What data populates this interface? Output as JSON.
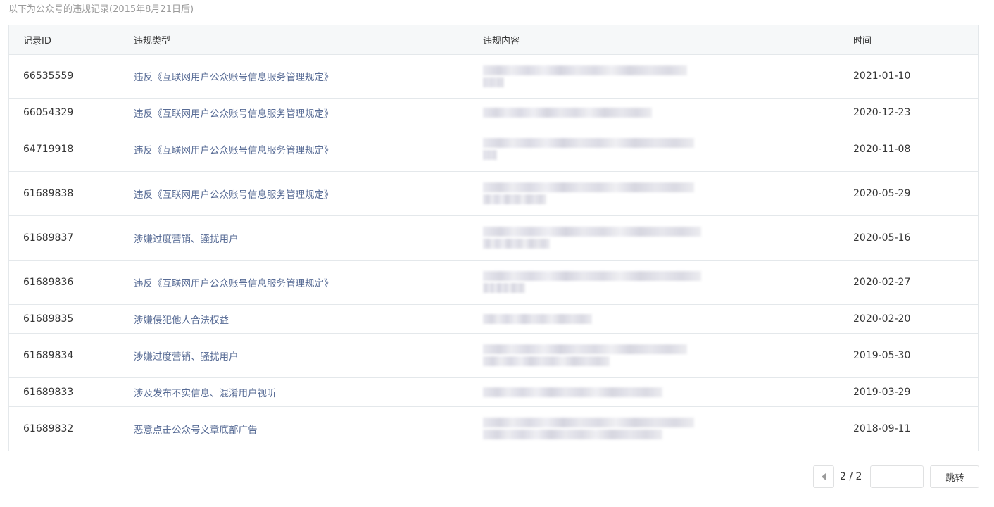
{
  "caption": "以下为公众号的违规记录(2015年8月21日后)",
  "table": {
    "headers": {
      "id": "记录ID",
      "type": "违规类型",
      "content": "违规内容",
      "time": "时间"
    },
    "rows": [
      {
        "id": "66535559",
        "type": "违反《互联网用户公众账号信息服务管理规定》",
        "time": "2021-01-10",
        "blur_lines": 2
      },
      {
        "id": "66054329",
        "type": "违反《互联网用户公众账号信息服务管理规定》",
        "time": "2020-12-23",
        "blur_lines": 1
      },
      {
        "id": "64719918",
        "type": "违反《互联网用户公众账号信息服务管理规定》",
        "time": "2020-11-08",
        "blur_lines": 2
      },
      {
        "id": "61689838",
        "type": "违反《互联网用户公众账号信息服务管理规定》",
        "time": "2020-05-29",
        "blur_lines": 2
      },
      {
        "id": "61689837",
        "type": "涉嫌过度营销、骚扰用户",
        "time": "2020-05-16",
        "blur_lines": 2
      },
      {
        "id": "61689836",
        "type": "违反《互联网用户公众账号信息服务管理规定》",
        "time": "2020-02-27",
        "blur_lines": 2
      },
      {
        "id": "61689835",
        "type": "涉嫌侵犯他人合法权益",
        "time": "2020-02-20",
        "blur_lines": 1
      },
      {
        "id": "61689834",
        "type": "涉嫌过度营销、骚扰用户",
        "time": "2019-05-30",
        "blur_lines": 2
      },
      {
        "id": "61689833",
        "type": "涉及发布不实信息、混淆用户视听",
        "time": "2019-03-29",
        "blur_lines": 1
      },
      {
        "id": "61689832",
        "type": "恶意点击公众号文章底部广告",
        "time": "2018-09-11",
        "blur_lines": 2
      }
    ]
  },
  "pagination": {
    "page_label": "2 / 2",
    "input_value": "",
    "input_placeholder": "",
    "jump_label": "跳转",
    "prev_icon": "triangle-left-icon"
  }
}
